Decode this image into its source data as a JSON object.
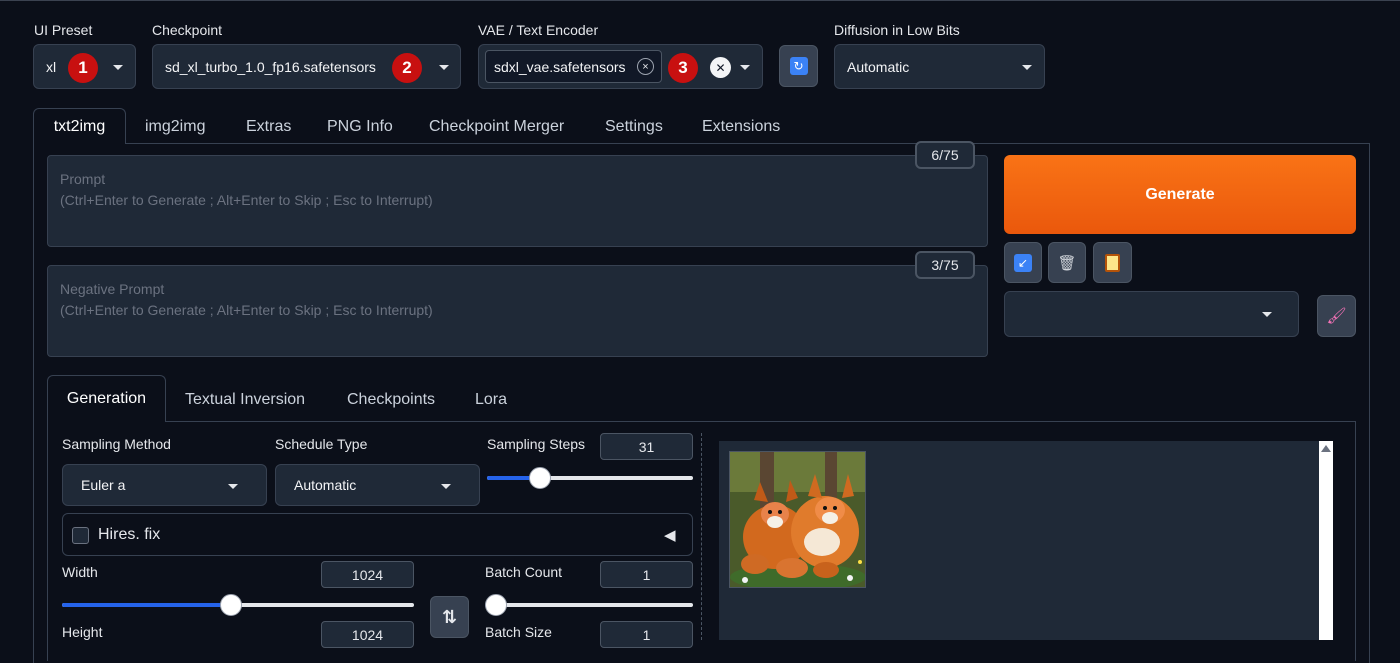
{
  "presets": {
    "ui_preset": {
      "label": "UI Preset",
      "value": "xl",
      "badge": "1"
    },
    "checkpoint": {
      "label": "Checkpoint",
      "value": "sd_xl_turbo_1.0_fp16.safetensors",
      "badge": "2"
    },
    "vae": {
      "label": "VAE / Text Encoder",
      "chip": "sdxl_vae.safetensors",
      "chip_remove": "×",
      "clear": "✕",
      "badge": "3"
    },
    "refresh": "🔄",
    "diffusion": {
      "label": "Diffusion in Low Bits",
      "value": "Automatic"
    }
  },
  "main_tabs": [
    "txt2img",
    "img2img",
    "Extras",
    "PNG Info",
    "Checkpoint Merger",
    "Settings",
    "Extensions"
  ],
  "prompt": {
    "placeholder_title": "Prompt",
    "placeholder_hint": "(Ctrl+Enter to Generate ; Alt+Enter to Skip ; Esc to Interrupt)",
    "counter": "6/75"
  },
  "negative_prompt": {
    "placeholder_title": "Negative Prompt",
    "placeholder_hint": "(Ctrl+Enter to Generate ; Alt+Enter to Skip ; Esc to Interrupt)",
    "counter": "3/75"
  },
  "generate": "Generate",
  "accent": "#ea580c",
  "sub_tabs": [
    "Generation",
    "Textual Inversion",
    "Checkpoints",
    "Lora"
  ],
  "sampling": {
    "method_label": "Sampling Method",
    "method_value": "Euler a",
    "schedule_label": "Schedule Type",
    "schedule_value": "Automatic",
    "steps_label": "Sampling Steps",
    "steps_value": "31",
    "steps_fraction": 0.23
  },
  "hires": {
    "label": "Hires. fix",
    "toggle": "◀"
  },
  "width": {
    "label": "Width",
    "value": "1024",
    "fraction": 0.48
  },
  "height": {
    "label": "Height",
    "value": "1024"
  },
  "swap": "⇅",
  "batch_count": {
    "label": "Batch Count",
    "value": "1",
    "fraction": 0.0
  },
  "batch_size": {
    "label": "Batch Size",
    "value": "1"
  },
  "gallery": {
    "image_alt": "foxes"
  }
}
